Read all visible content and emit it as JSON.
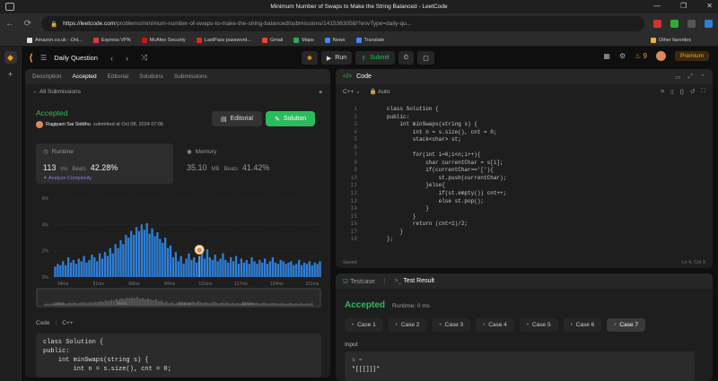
{
  "window": {
    "title": "Minimum Number of Swaps to Make the String Balanced - LeetCode",
    "controls": [
      "—",
      "❐",
      "✕"
    ]
  },
  "browser": {
    "url_host": "https://leetcode.com",
    "url_path": "/problems/minimum-number-of-swaps-to-make-the-string-balanced/submissions/1415363058/?envType=daily-qu...",
    "bookmarks": [
      {
        "label": "Amazon.co.uk - Onl...",
        "color": "#e0e0e0"
      },
      {
        "label": "Express VPN",
        "color": "#da3940"
      },
      {
        "label": "McAfee Security",
        "color": "#c01818"
      },
      {
        "label": "LastPass password...",
        "color": "#d32d27"
      },
      {
        "label": "Gmail",
        "color": "#ea4335"
      },
      {
        "label": "Maps",
        "color": "#34a853"
      },
      {
        "label": "News",
        "color": "#4285f4"
      },
      {
        "label": "Translate",
        "color": "#4285f4"
      }
    ],
    "other_favorites": "Other favorites"
  },
  "header": {
    "logo": "◀",
    "title": "Daily Question",
    "run": "Run",
    "submit": "Submit",
    "streak": "9",
    "premium": "Premium"
  },
  "left_tabs": [
    "Description",
    "Accepted",
    "Editorial",
    "Solutions",
    "Submissions"
  ],
  "all_submissions": "All Submissions",
  "submission": {
    "status": "Accepted",
    "user": "Ragipani Sai Siddhu",
    "submitted": "submitted at Oct 08, 2024 07:06",
    "editorial_btn": "Editorial",
    "solution_btn": "Solution",
    "runtime_label": "Runtime",
    "runtime_value": "113",
    "runtime_unit": "ms",
    "beats": "Beats",
    "runtime_pct": "42.28%",
    "analyze": "Analyze Complexity",
    "memory_label": "Memory",
    "memory_value": "35.10",
    "memory_unit": "MB",
    "memory_pct": "41.42%"
  },
  "chart_data": {
    "type": "bar",
    "yticks": [
      "6%",
      "4%",
      "2%",
      "0%"
    ],
    "ylim": [
      0,
      6
    ],
    "xticks": [
      "34ms",
      "51ms",
      "68ms",
      "84ms",
      "101ms",
      "117ms",
      "134ms",
      "151ms"
    ],
    "values": [
      0.8,
      1.0,
      0.9,
      1.2,
      0.9,
      1.5,
      1.1,
      1.3,
      1.0,
      1.4,
      1.2,
      1.6,
      1.1,
      1.3,
      1.7,
      1.5,
      1.2,
      1.8,
      1.4,
      1.9,
      1.6,
      2.2,
      1.8,
      2.5,
      2.2,
      2.8,
      2.5,
      3.2,
      3.0,
      3.5,
      3.2,
      3.8,
      3.5,
      4.0,
      3.6,
      4.1,
      3.3,
      3.7,
      3.1,
      3.4,
      2.9,
      2.6,
      3.0,
      2.2,
      2.4,
      1.5,
      1.9,
      1.2,
      1.6,
      1.0,
      1.4,
      1.8,
      1.3,
      1.5,
      1.1,
      1.6,
      1.9,
      1.4,
      2.1,
      1.5,
      1.3,
      1.7,
      1.2,
      1.4,
      1.8,
      1.3,
      1.1,
      1.5,
      1.2,
      1.6,
      1.0,
      1.4,
      1.1,
      1.3,
      1.0,
      1.5,
      1.2,
      1.0,
      1.3,
      1.1,
      1.4,
      1.0,
      1.2,
      1.5,
      1.1,
      1.0,
      1.3,
      1.2,
      1.0,
      1.1,
      1.2,
      0.9,
      1.0,
      1.3,
      0.9,
      1.1,
      1.0,
      1.2,
      0.9,
      1.1,
      1.0,
      1.2
    ],
    "highlight_index": 55,
    "mini_ticks": [
      "34ms",
      "68ms",
      "101ms",
      "134ms"
    ]
  },
  "left_code": {
    "lang_label": "Code",
    "lang": "C++",
    "lines": [
      "class Solution {",
      "public:",
      "    int minSwaps(string s) {",
      "        int n = s.size(), cnt = 0;"
    ]
  },
  "code_panel": {
    "title": "Code",
    "lang": "C++",
    "auto": "Auto",
    "saved": "Saved",
    "cursor": "Ln 4, Col 9"
  },
  "editor_lines": [
    "class Solution {",
    "public:",
    "    int minSwaps(string s) {",
    "        int n = s.size(), cnt = 0;",
    "        stack<char> st;",
    "",
    "        for(int i=0;i<n;i++){",
    "            char currentChar = s[i];",
    "            if(currentChar=='['){",
    "                st.push(currentChar);",
    "            }else{",
    "                if(st.empty()) cnt++;",
    "                else st.pop();",
    "            }",
    "        }",
    "        return (cnt+1)/2;",
    "    }",
    "};"
  ],
  "bottom": {
    "tab_testcase": "Testcase",
    "tab_result": "Test Result",
    "status": "Accepted",
    "runtime": "Runtime: 0 ms",
    "cases": [
      "Case 1",
      "Case 2",
      "Case 3",
      "Case 4",
      "Case 5",
      "Case 6",
      "Case 7"
    ],
    "input_label": "Input",
    "input_var": "s =",
    "input_value": "\"[[[]]]\""
  }
}
